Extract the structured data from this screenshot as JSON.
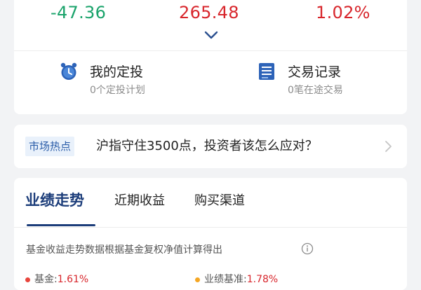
{
  "stats": [
    {
      "value": "-47.36",
      "trend": "down"
    },
    {
      "value": "265.48",
      "trend": "up"
    },
    {
      "value": "1.02%",
      "trend": "up"
    }
  ],
  "shortcuts": [
    {
      "title": "我的定投",
      "subtitle": "0个定投计划",
      "icon": "alarm-clock-icon"
    },
    {
      "title": "交易记录",
      "subtitle": "0笔在途交易",
      "icon": "document-list-icon"
    }
  ],
  "hot_topic": {
    "tag": "市场热点",
    "text": "沪指守住3500点，投资者该怎么应对？"
  },
  "performance": {
    "tabs": [
      "业绩走势",
      "近期收益",
      "购买渠道"
    ],
    "active_tab": 0,
    "note": "基金收益走势数据根据基金复权净值计算得出",
    "legend": [
      {
        "label": "基金:",
        "value": "1.61%",
        "color": "#e8453c"
      },
      {
        "label": "业绩基准:",
        "value": "1.78%",
        "color": "#f5a623"
      }
    ]
  },
  "colors": {
    "negative": "#1aa36b",
    "positive": "#d8262c",
    "brand": "#1c3d7a"
  }
}
